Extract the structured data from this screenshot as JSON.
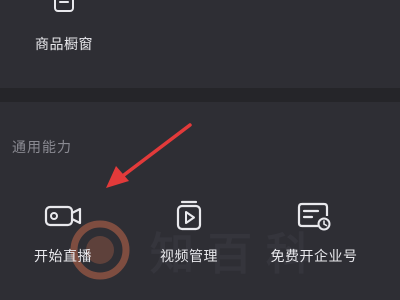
{
  "shop_section": {
    "items": [
      {
        "label": "商品橱窗",
        "icon": "shop-window-icon"
      }
    ]
  },
  "common_section": {
    "title": "通用能力",
    "items": [
      {
        "label": "开始直播",
        "icon": "live-camera-icon"
      },
      {
        "label": "视频管理",
        "icon": "video-manage-icon"
      },
      {
        "label": "免费开企业号",
        "icon": "enterprise-account-icon"
      }
    ]
  },
  "annotation": {
    "arrow_color": "#e23a3a"
  },
  "watermark": {
    "text": "知百科"
  },
  "colors": {
    "background": "#2b2b31",
    "card": "#2e2e34",
    "label_text": "#e9e9ed",
    "section_title": "#8a8a92",
    "icon_stroke": "#e9e9ed"
  }
}
